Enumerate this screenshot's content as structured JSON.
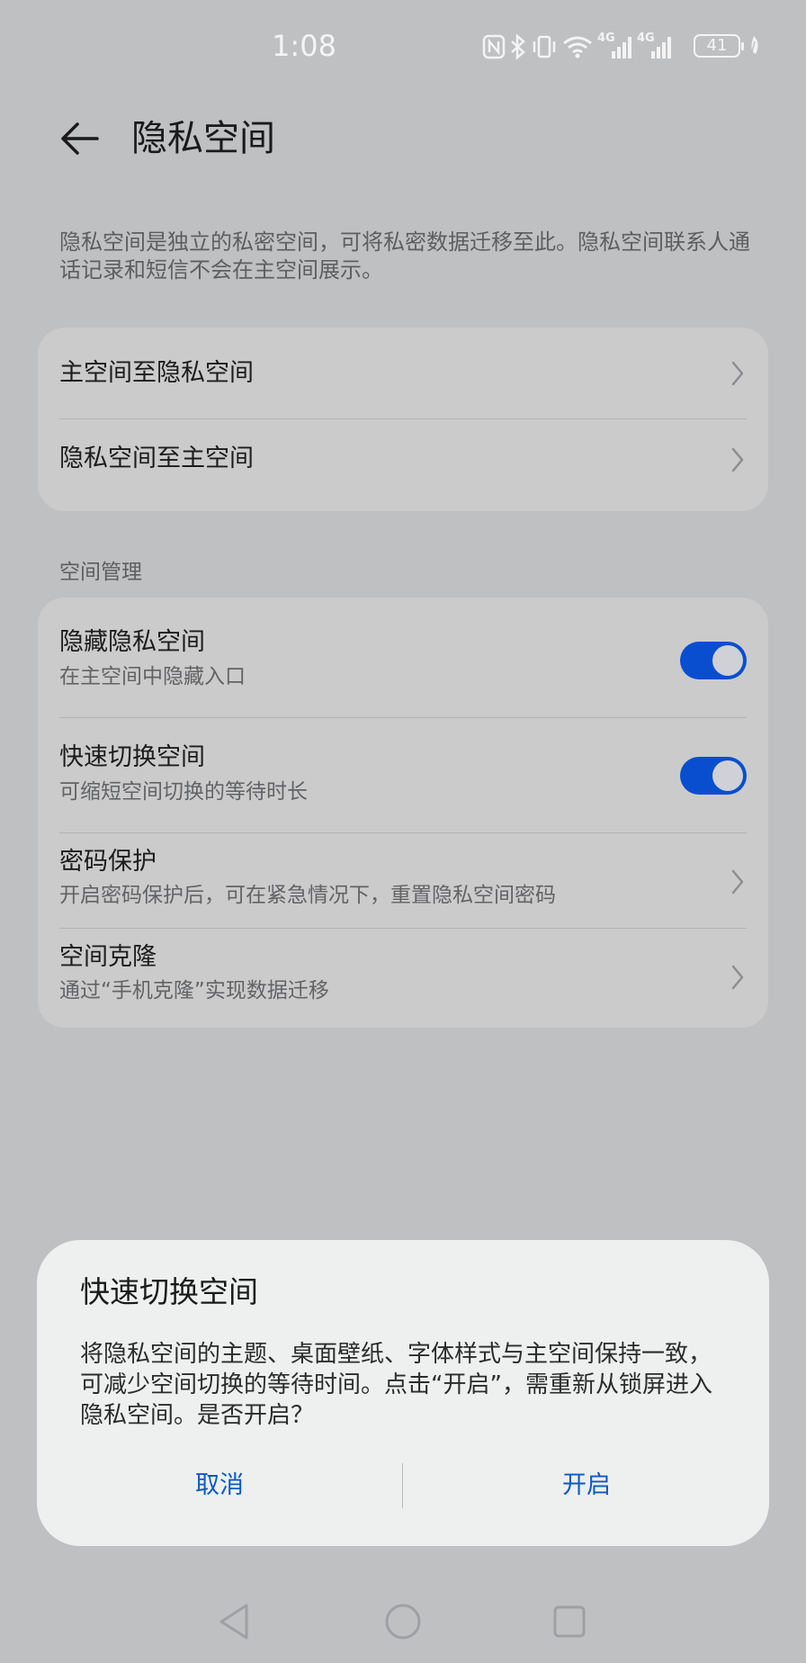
{
  "status_bar": {
    "time": "1:08",
    "battery": "41",
    "icons": [
      "nfc-icon",
      "bluetooth-icon",
      "vibrate-icon",
      "wifi-icon",
      "signal-4g-icon",
      "signal-4g-icon",
      "battery-icon",
      "leaf-icon"
    ],
    "network_label_1": "4G",
    "network_label_2": "4G"
  },
  "header": {
    "title": "隐私空间"
  },
  "description": "隐私空间是独立的私密空间，可将私密数据迁移至此。隐私空间联系人通话记录和短信不会在主空间展示。",
  "migration": {
    "items": [
      {
        "title": "主空间至隐私空间"
      },
      {
        "title": "隐私空间至主空间"
      }
    ]
  },
  "space_management": {
    "label": "空间管理",
    "items": [
      {
        "title": "隐藏隐私空间",
        "subtitle": "在主空间中隐藏入口",
        "toggle_on": true
      },
      {
        "title": "快速切换空间",
        "subtitle": "可缩短空间切换的等待时长",
        "toggle_on": true
      },
      {
        "title": "密码保护",
        "subtitle": "开启密码保护后，可在紧急情况下，重置隐私空间密码"
      },
      {
        "title": "空间克隆",
        "subtitle": "通过“手机克隆”实现数据迁移"
      }
    ]
  },
  "dialog": {
    "title": "快速切换空间",
    "body": "将隐私空间的主题、桌面壁纸、字体样式与主空间保持一致，可减少空间切换的等待时间。点击“开启”，需重新从锁屏进入隐私空间。是否开启？",
    "cancel_label": "取消",
    "confirm_label": "开启"
  },
  "colors": {
    "accent": "#0a4ed0",
    "dialog_button": "#0a59c8",
    "background": "#bfc0c2",
    "card": "#cbcbcc"
  }
}
